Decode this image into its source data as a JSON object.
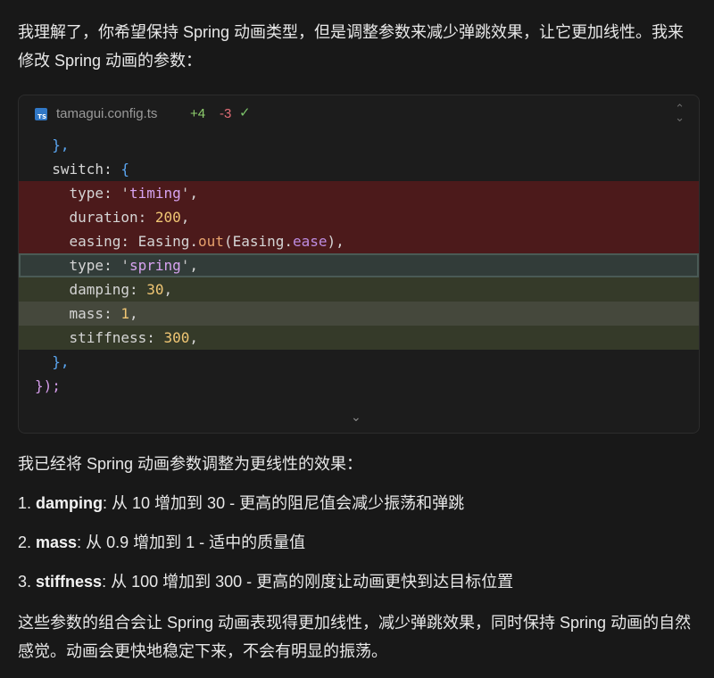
{
  "intro_text": "我理解了，你希望保持 Spring 动画类型，但是调整参数来减少弹跳效果，让它更加线性。我来修改 Spring 动画的参数：",
  "code_block": {
    "filename": "tamagui.config.ts",
    "additions": "+4",
    "deletions": "-3",
    "file_icon": "typescript-icon",
    "check_icon": "check-icon",
    "expand_icon": "expand-icon",
    "collapse_icon": "chevron-down-icon",
    "lines": [
      {
        "text": "  },",
        "kind": "context"
      },
      {
        "text": "  switch: {",
        "kind": "context"
      },
      {
        "text": "    type: 'timing',",
        "kind": "removed"
      },
      {
        "text": "    duration: 200,",
        "kind": "removed"
      },
      {
        "text": "    easing: Easing.out(Easing.ease),",
        "kind": "removed"
      },
      {
        "text": "    type: 'spring',",
        "kind": "added"
      },
      {
        "text": "    damping: 30,",
        "kind": "added"
      },
      {
        "text": "    mass: 1,",
        "kind": "added"
      },
      {
        "text": "    stiffness: 300,",
        "kind": "added"
      },
      {
        "text": "  },",
        "kind": "context"
      },
      {
        "text": "});",
        "kind": "context"
      }
    ]
  },
  "summary_intro": "我已经将 Spring 动画参数调整为更线性的效果：",
  "list": [
    {
      "num": "1.",
      "term": "damping",
      "text": ": 从 10 增加到 30 - 更高的阻尼值会减少振荡和弹跳"
    },
    {
      "num": "2.",
      "term": "mass",
      "text": ": 从 0.9 增加到 1 - 适中的质量值"
    },
    {
      "num": "3.",
      "term": "stiffness",
      "text": ": 从 100 增加到 300 - 更高的刚度让动画更快到达目标位置"
    }
  ],
  "conclusion": "这些参数的组合会让 Spring 动画表现得更加线性，减少弹跳效果，同时保持 Spring 动画的自然感觉。动画会更快地稳定下来，不会有明显的振荡。",
  "colors": {
    "background": "#181818",
    "removed_line": "#4c1a1b",
    "added_line": "#353a29",
    "addition_count": "#8fcf6e",
    "deletion_count": "#e06c75"
  }
}
